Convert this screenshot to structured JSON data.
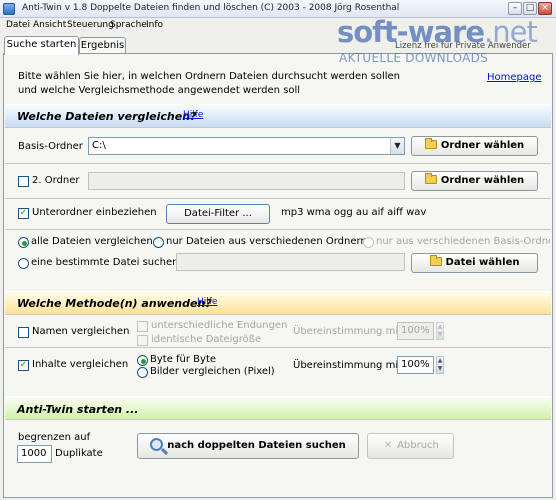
{
  "window": {
    "title": "Anti-Twin   v 1.8    Doppelte Dateien finden und löschen   (C) 2003 - 2008  Jörg Rosenthal",
    "minimize": "–",
    "maximize": "□",
    "close": "×"
  },
  "menu": [
    "Datei",
    "Ansicht",
    "Steuerung",
    "Sprache",
    "Info"
  ],
  "tabs": [
    "Suche starten",
    "Ergebnis"
  ],
  "watermark": {
    "brand": "soft-ware",
    "tld": ".net",
    "tagline": "AKTUELLE DOWNLOADS",
    "behind_text": "Lizenz frei für Private Anwender"
  },
  "intro": {
    "line1": "Bitte wählen Sie hier, in welchen Ordnern Dateien durchsucht werden sollen",
    "line2": "und welche Vergleichsmethode angewendet werden soll",
    "homepage": "Homepage"
  },
  "section1": {
    "title": "Welche Dateien vergleichen?",
    "help": "Hilfe",
    "basis_label": "Basis-Ordner",
    "basis_value": "C:\\",
    "choose_folder": "Ordner wählen",
    "second_label": "2. Ordner",
    "second_value": "",
    "second_checked": false,
    "choose_folder2": "Ordner wählen",
    "subfolders_label": "Unterordner einbeziehen",
    "subfolders_checked": true,
    "filter_button": "Datei-Filter ...",
    "filter_value": "mp3 wma ogg au aif aiff wav",
    "radio_all": "alle Dateien vergleichen",
    "radio_diff": "nur Dateien aus verschiedenen Ordnern",
    "radio_diff_base": "nur aus verschiedenen Basis-Ordnern",
    "radio_one": "eine bestimmte Datei suchen",
    "choose_file": "Datei wählen",
    "selected_radio": "all"
  },
  "section2": {
    "title": "Welche Methode(n) anwenden?",
    "help": "Hilfe",
    "names_label": "Namen vergleichen",
    "names_checked": false,
    "diff_endings": "unterschiedliche Endungen",
    "same_size": "identische Dateigröße",
    "match_label_1": "Übereinstimmung min.",
    "match_value_1": "100%",
    "content_label": "Inhalte vergleichen",
    "content_checked": true,
    "byte_label": "Byte für Byte",
    "image_label": "Bilder vergleichen (Pixel)",
    "selected_method": "byte",
    "match_label_2": "Übereinstimmung min.",
    "match_value_2": "100%"
  },
  "section3": {
    "title": "Anti-Twin starten ...",
    "limit_label": "begrenzen auf",
    "limit_value": "1000",
    "limit_unit": "Duplikate",
    "search_button": "nach doppelten Dateien suchen",
    "cancel_button": "Abbruch"
  },
  "colors": {
    "accent": "#1c5180",
    "link": "#0018c8",
    "check": "#21a121"
  }
}
